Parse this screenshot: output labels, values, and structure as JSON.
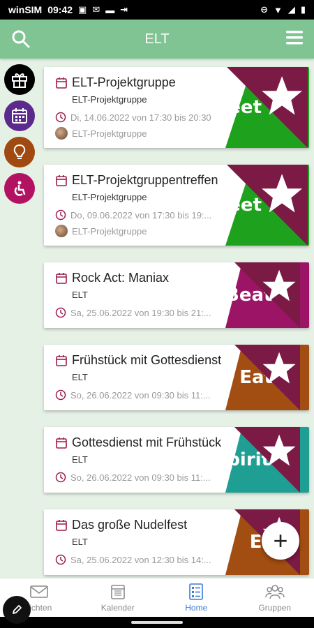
{
  "status_bar": {
    "carrier": "winSIM",
    "time": "09:42"
  },
  "app_bar": {
    "title": "ELT",
    "search_icon": "search-icon",
    "menu_icon": "menu-icon"
  },
  "categories": [
    {
      "name": "gift",
      "color": "#000000"
    },
    {
      "name": "calendar",
      "color": "#5b2a8c"
    },
    {
      "name": "bulb",
      "color": "#a04a12"
    },
    {
      "name": "accessibility",
      "color": "#b21262"
    }
  ],
  "events": [
    {
      "title": "ELT-Projektgruppe",
      "group": "ELT-Projektgruppe",
      "date": "Di, 14.06.2022 von 17:30 bis 20:30",
      "organizer": "ELT-Projektgruppe",
      "banner": "eet",
      "banner_color": "#1ea21e",
      "banner_icon": "handshake-icon"
    },
    {
      "title": "ELT-Projektgruppentreffen",
      "group": "ELT-Projektgruppe",
      "date": "Do, 09.06.2022 von 17:30 bis 19:...",
      "organizer": "ELT-Projektgruppe",
      "banner": "eet",
      "banner_color": "#1ea21e",
      "banner_icon": "handshake-icon"
    },
    {
      "title": "Rock Act: Maniax",
      "group": "ELT",
      "date": "Sa, 25.06.2022 von 19:30 bis 21:...",
      "banner": "Beat",
      "banner_color": "#9c1466",
      "banner_icon": "music-icon"
    },
    {
      "title": "Frühstück mit Gottesdienst",
      "group": "ELT",
      "date": "So, 26.06.2022 von 09:30 bis 11:...",
      "banner": "Eat",
      "banner_color": "#a24d12",
      "banner_icon": "cutlery-icon"
    },
    {
      "title": "Gottesdienst mit Frühstück",
      "group": "ELT",
      "date": "So, 26.06.2022 von 09:30 bis 11:...",
      "banner": "pirit",
      "banner_color": "#1f9e93",
      "banner_icon": "dove-icon"
    },
    {
      "title": "Das große Nudelfest",
      "group": "ELT",
      "date": "Sa, 25.06.2022 von 12:30 bis 14:...",
      "banner": "Ea",
      "banner_color": "#a24d12",
      "banner_icon": "cutlery-icon"
    }
  ],
  "fab": {
    "label": "+"
  },
  "bottom_nav": [
    {
      "label": "richten",
      "icon": "mail-icon",
      "active": false
    },
    {
      "label": "Kalender",
      "icon": "calendar-icon",
      "active": false
    },
    {
      "label": "Home",
      "icon": "list-icon",
      "active": true
    },
    {
      "label": "Gruppen",
      "icon": "group-icon",
      "active": false
    }
  ]
}
